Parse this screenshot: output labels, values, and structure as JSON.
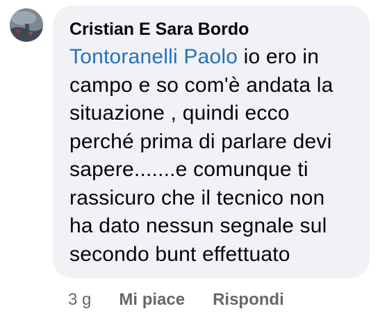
{
  "comment": {
    "author": "Cristian E Sara Bordo",
    "mention": "Tontoranelli Paolo",
    "lines": [
      " io ero in",
      "campo e so com'è andata la",
      "situazione , quindi ecco",
      "perché prima di parlare devi",
      "sapere.......e comunque ti",
      "rassicuro che il tecnico non",
      "ha dato nessun segnale sul",
      "secondo bunt effettuato"
    ],
    "timestamp": "3 g",
    "like_label": "Mi piace",
    "reply_label": "Rispondi"
  },
  "colors": {
    "bubble_bg": "#f0f2f5",
    "mention": "#2770b8",
    "meta_text": "#65676b",
    "text": "#050505"
  },
  "icons": {
    "avatar": "profile-photo"
  }
}
